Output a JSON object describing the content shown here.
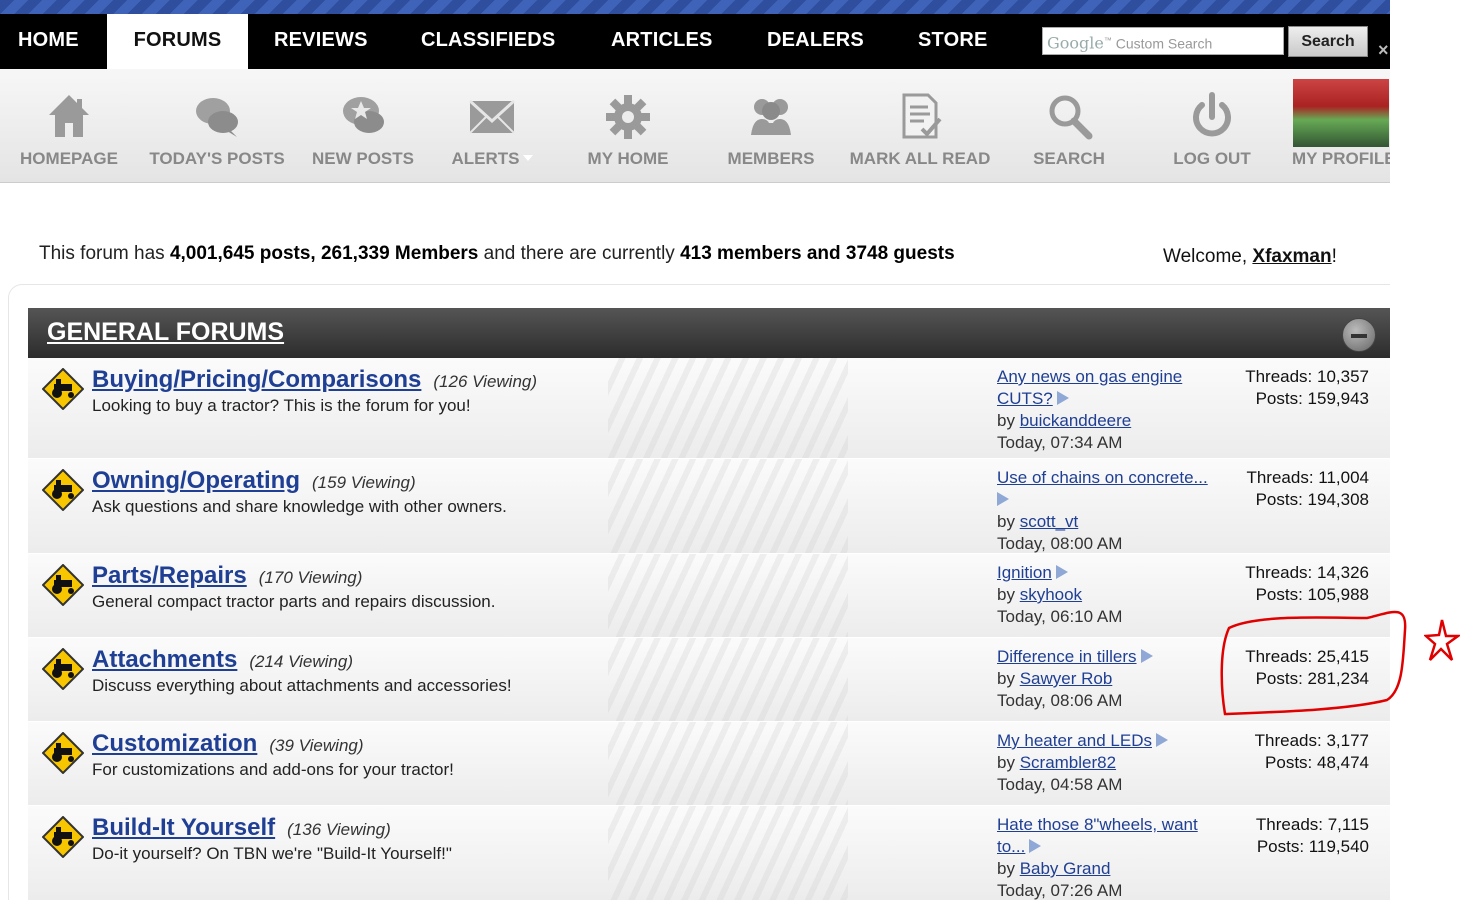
{
  "topnav": {
    "tabs": [
      "HOME",
      "FORUMS",
      "REVIEWS",
      "CLASSIFIEDS",
      "ARTICLES",
      "DEALERS",
      "STORE"
    ],
    "search_logo": "Google",
    "search_tm": "™",
    "search_placeholder": "Custom Search",
    "search_button": "Search",
    "close_glyph": "×"
  },
  "toolbar": {
    "items": [
      "HOMEPAGE",
      "TODAY'S POSTS",
      "NEW POSTS",
      "ALERTS",
      "MY HOME",
      "MEMBERS",
      "MARK ALL READ",
      "SEARCH",
      "LOG OUT",
      "MY PROFILE"
    ],
    "icons": [
      "home-icon",
      "chat-bubbles-icon",
      "star-chat-icon",
      "envelope-icon",
      "gear-icon",
      "members-icon",
      "document-check-icon",
      "magnifier-icon",
      "power-icon",
      "profile-photo"
    ]
  },
  "stats": {
    "prefix": "This forum has ",
    "posts": "4,001,645 posts, 261,339 Members",
    "middle": " and there are currently ",
    "online": "413 members and 3748 guests"
  },
  "welcome": {
    "prefix": "Welcome, ",
    "user": "Xfaxman",
    "suffix": "!"
  },
  "section": {
    "title": "GENERAL FORUMS"
  },
  "forums": [
    {
      "name": "Buying/Pricing/Comparisons",
      "viewing": "(126 Viewing)",
      "desc": "Looking to buy a tractor? This is the forum for you!",
      "last_title": "Any news on gas engine CUTS?",
      "by": "by ",
      "last_user": "buickanddeere",
      "last_time": "Today, 07:34 AM",
      "threads": "Threads: 10,357",
      "posts": "Posts: 159,943"
    },
    {
      "name": "Owning/Operating",
      "viewing": "(159 Viewing)",
      "desc": "Ask questions and share knowledge with other owners.",
      "last_title": "Use of chains on concrete...",
      "by": "by ",
      "last_user": "scott_vt",
      "last_time": "Today, 08:00 AM",
      "threads": "Threads: 11,004",
      "posts": "Posts: 194,308"
    },
    {
      "name": "Parts/Repairs",
      "viewing": "(170 Viewing)",
      "desc": "General compact tractor parts and repairs discussion.",
      "last_title": "Ignition",
      "by": "by ",
      "last_user": "skyhook",
      "last_time": "Today, 06:10 AM",
      "threads": "Threads: 14,326",
      "posts": "Posts: 105,988"
    },
    {
      "name": "Attachments",
      "viewing": "(214 Viewing)",
      "desc": "Discuss everything about attachments and accessories!",
      "last_title": "Difference in tillers",
      "by": "by ",
      "last_user": "Sawyer Rob",
      "last_time": "Today, 08:06 AM",
      "threads": "Threads: 25,415",
      "posts": "Posts: 281,234"
    },
    {
      "name": "Customization",
      "viewing": "(39 Viewing)",
      "desc": "For customizations and add-ons for your tractor!",
      "last_title": "My heater and LEDs",
      "by": "by ",
      "last_user": "Scrambler82",
      "last_time": "Today, 04:58 AM",
      "threads": "Threads: 3,177",
      "posts": "Posts: 48,474"
    },
    {
      "name": "Build-It Yourself",
      "viewing": "(136 Viewing)",
      "desc": "Do-it yourself? On TBN we're \"Build-It Yourself!\"",
      "last_title": "Hate those 8\"wheels, want to...",
      "by": "by ",
      "last_user": "Baby Grand",
      "last_time": "Today, 07:26 AM",
      "threads": "Threads: 7,115",
      "posts": "Posts: 119,540"
    }
  ],
  "colors": {
    "link": "#1f3f94",
    "annotation": "#e00000",
    "nav_bg": "#000000"
  }
}
